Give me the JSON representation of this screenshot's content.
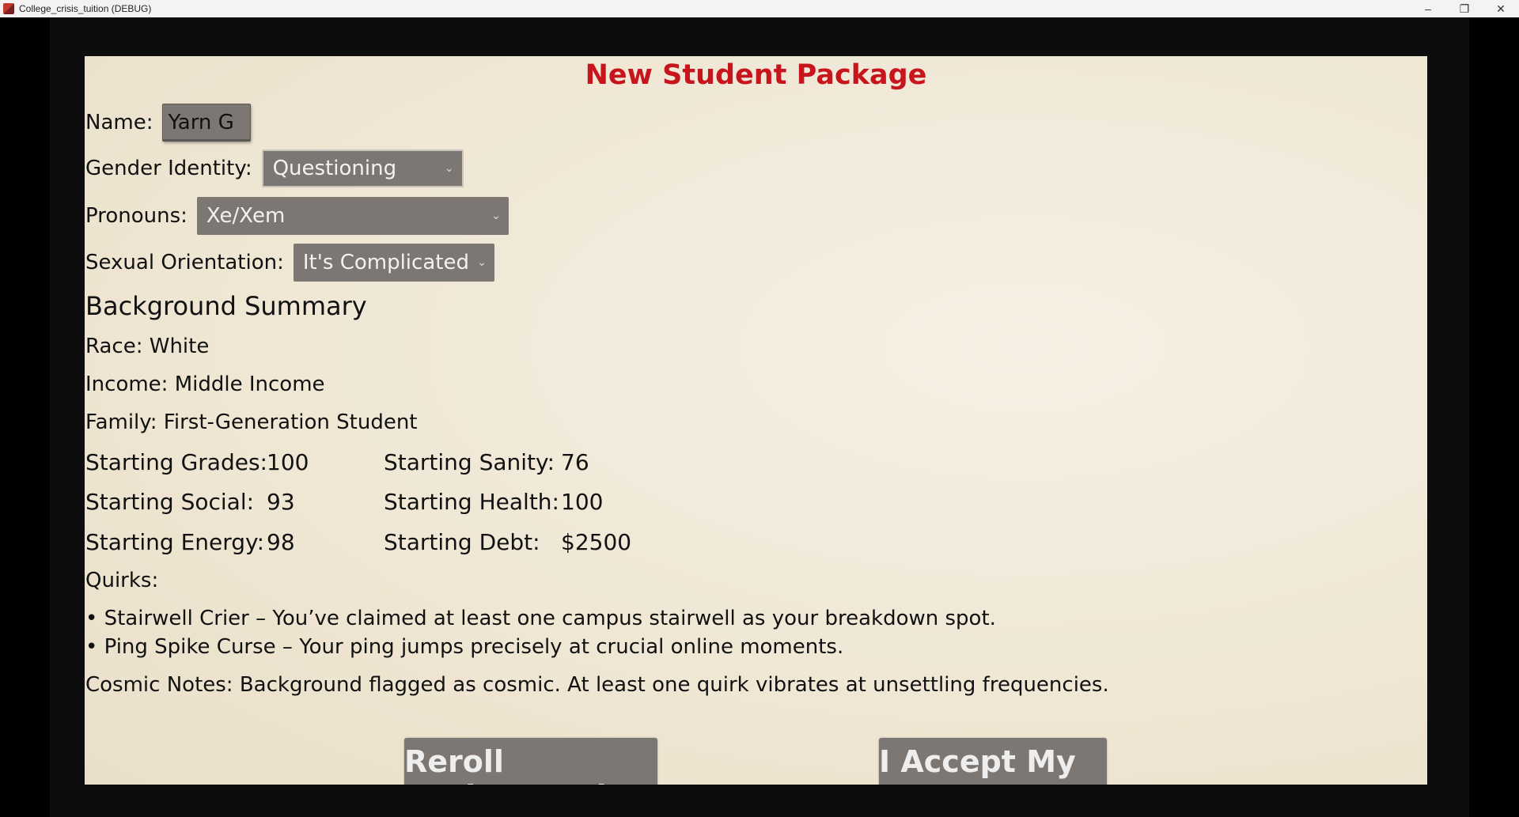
{
  "window": {
    "title": "College_crisis_tuition (DEBUG)",
    "minimize": "–",
    "restore": "❐",
    "close": "✕"
  },
  "screen": {
    "title": "New Student Package",
    "name": {
      "label": "Name:",
      "value": "Yarn G"
    },
    "gender": {
      "label": "Gender Identity:",
      "value": "Questioning"
    },
    "pronouns": {
      "label": "Pronouns:",
      "value": "Xe/Xem"
    },
    "orientation": {
      "label": "Sexual Orientation:",
      "value": "It's Complicated"
    },
    "background_heading": "Background Summary",
    "race": "Race: White",
    "income": "Income: Middle Income",
    "family": "Family: First-Generation Student",
    "stats": {
      "grades_label": "Starting Grades:",
      "grades_value": "100",
      "social_label": "Starting Social:",
      "social_value": "93",
      "energy_label": "Starting Energy:",
      "energy_value": "98",
      "sanity_label": "Starting Sanity:",
      "sanity_value": "76",
      "health_label": "Starting Health:",
      "health_value": "100",
      "debt_label": "Starting Debt:",
      "debt_value": "$2500"
    },
    "quirks_label": "Quirks:",
    "quirks": [
      "• Stairwell Crier – You’ve claimed at least one campus stairwell as your breakdown spot.",
      "• Ping Spike Curse – Your ping jumps precisely at crucial online moments."
    ],
    "cosmic_notes": "Cosmic Notes: Background flagged as cosmic. At least one quirk vibrates at unsettling frequencies.",
    "reroll_button": "Reroll Background",
    "accept_button": "I Accept My Fate"
  },
  "colors": {
    "title_red": "#c8151d",
    "control_gray": "#7d7773",
    "paper": "#efe6d3"
  },
  "icons": {
    "dropdown": "chevron-down-icon",
    "app": "app-icon"
  }
}
